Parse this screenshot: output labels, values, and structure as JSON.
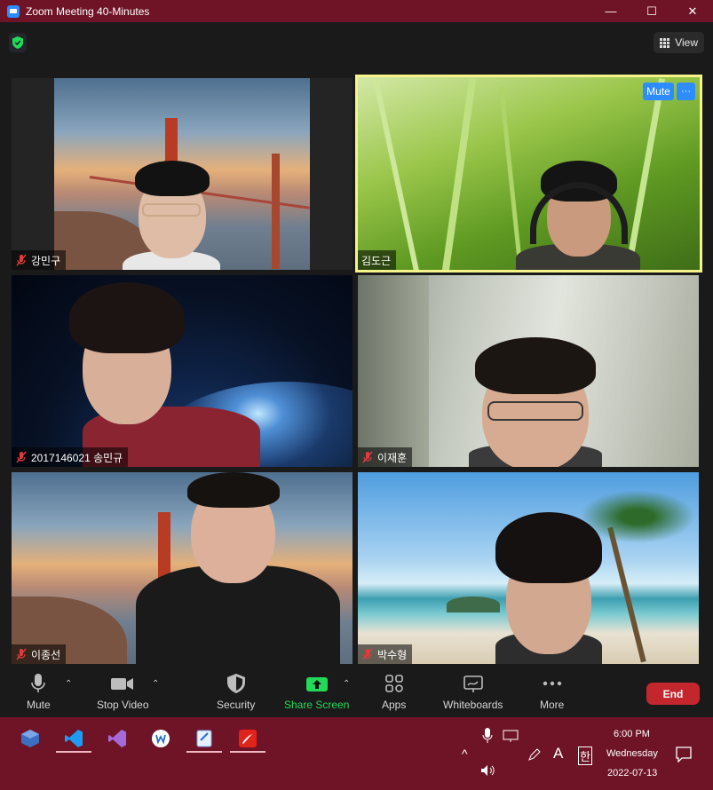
{
  "window": {
    "title": "Zoom Meeting 40-Minutes",
    "minimize": "—",
    "maximize": "☐",
    "close": "✕"
  },
  "topbar": {
    "view_label": "View"
  },
  "participants": [
    {
      "name": "강민구"
    },
    {
      "name": "김도근",
      "mute_label": "Mute",
      "more_label": "···"
    },
    {
      "name": "2017146021 송민규"
    },
    {
      "name": "이재훈"
    },
    {
      "name": "이종선"
    },
    {
      "name": "박수형"
    }
  ],
  "toolbar": {
    "mute": "Mute",
    "stop_video": "Stop Video",
    "security": "Security",
    "share_screen": "Share Screen",
    "apps": "Apps",
    "whiteboards": "Whiteboards",
    "more": "More",
    "end": "End"
  },
  "taskbar": {
    "time": "6:00 PM",
    "day": "Wednesday",
    "date": "2022-07-13",
    "ime_a": "A",
    "ime_han": "한"
  },
  "colors": {
    "accent": "#2d8cff",
    "share": "#23d959",
    "end": "#c4262e",
    "active_speaker": "#f6f38a",
    "taskbar": "#6e1426"
  }
}
